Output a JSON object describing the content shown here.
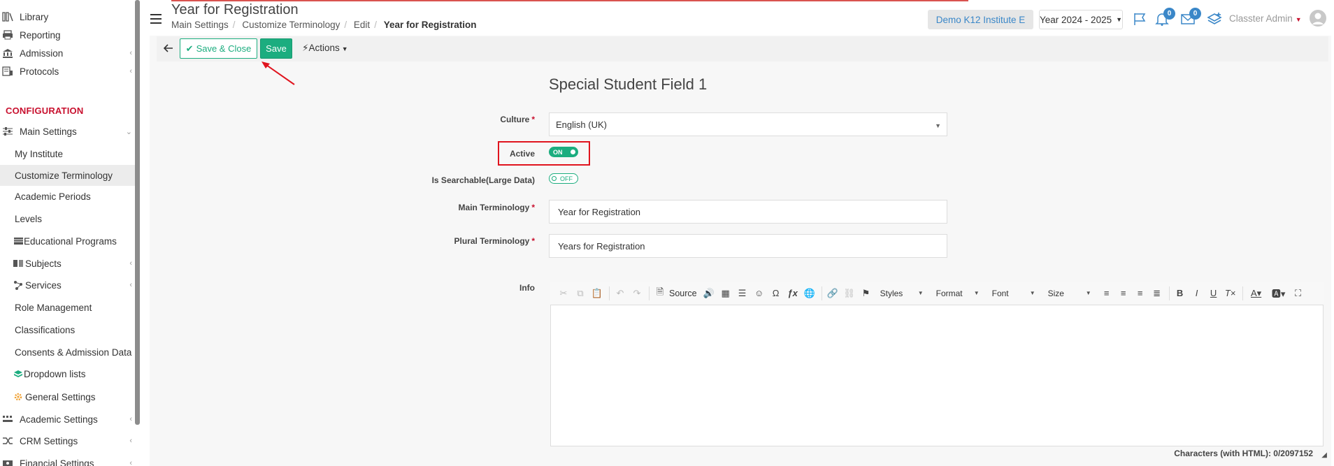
{
  "sidebar": {
    "items": [
      {
        "label": "Library",
        "icon": "library-icon"
      },
      {
        "label": "Reporting",
        "icon": "printer-icon"
      },
      {
        "label": "Admission",
        "icon": "bank-icon"
      },
      {
        "label": "Protocols",
        "icon": "protocols-icon"
      }
    ],
    "section_title": "CONFIGURATION",
    "main_settings": "Main Settings",
    "sub_items": [
      {
        "label": "My Institute"
      },
      {
        "label": "Customize Terminology"
      },
      {
        "label": "Academic Periods"
      },
      {
        "label": "Levels"
      },
      {
        "label": "Educational Programs"
      },
      {
        "label": "Subjects"
      },
      {
        "label": "Services"
      },
      {
        "label": "Role Management"
      },
      {
        "label": "Classifications"
      },
      {
        "label": "Consents & Admission Data"
      },
      {
        "label": "Dropdown lists"
      },
      {
        "label": "General Settings"
      }
    ],
    "bottom_items": [
      {
        "label": "Academic Settings"
      },
      {
        "label": "CRM Settings"
      },
      {
        "label": "Financial Settings"
      }
    ]
  },
  "header": {
    "title": "Year for Registration",
    "breadcrumb": [
      "Main Settings",
      "Customize Terminology",
      "Edit",
      "Year for Registration"
    ],
    "institute": "Demo K12 Institute E",
    "year": "Year 2024 - 2025",
    "notifications_count": "0",
    "messages_count": "0",
    "user": "Classter Admin"
  },
  "toolbar": {
    "save_close_label": "Save & Close",
    "save_label": "Save",
    "actions_label": "Actions"
  },
  "form": {
    "title": "Special Student Field 1",
    "culture_label": "Culture",
    "culture_value": "English (UK)",
    "active_label": "Active",
    "active_state": "ON",
    "searchable_label": "Is Searchable(Large Data)",
    "searchable_state": "OFF",
    "main_term_label": "Main Terminology",
    "main_term_value": "Year for Registration",
    "plural_term_label": "Plural Terminology",
    "plural_term_value": "Years for Registration",
    "info_label": "Info"
  },
  "editor": {
    "source_label": "Source",
    "styles_label": "Styles",
    "format_label": "Format",
    "font_label": "Font",
    "size_label": "Size",
    "char_count": "Characters (with HTML): 0/2097152"
  },
  "colors": {
    "accent": "#1cad7f",
    "link": "#3a87c8",
    "danger": "#c8102e",
    "highlight": "#e0141e"
  }
}
